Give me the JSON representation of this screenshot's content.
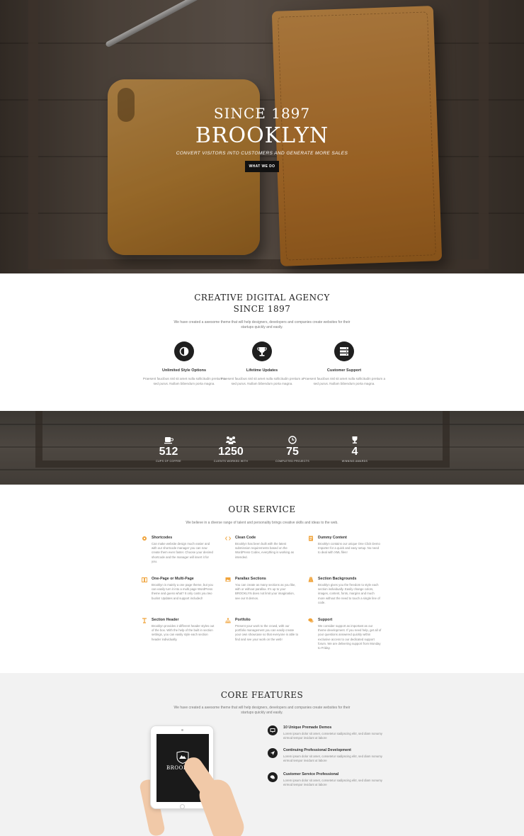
{
  "hero": {
    "since": "SINCE 1897",
    "title": "BROOKLYN",
    "subtitle": "CONVERT VISITORS INTO CUSTOMERS AND GENERATE MORE SALES",
    "button": "WHAT WE DO"
  },
  "agency": {
    "title_line1": "CREATIVE DIGITAL AGENCY",
    "title_line2": "SINCE 1897",
    "intro": "We have created a awesome theme that will help designers, developers and companies create websites for their startups quickly and easily.",
    "features": [
      {
        "icon": "contrast-icon",
        "title": "Unlimited Style Options",
        "desc": "Praesent faucibus nisl sit amet nulla sollicitudin pretium a sed purus. Nullam bibendum porta magna."
      },
      {
        "icon": "trophy-icon",
        "title": "Lifetime Updates",
        "desc": "Praesent faucibus nisl sit amet nulla sollicitudin pretium a sed purus. Nullam bibendum porta magna."
      },
      {
        "icon": "server-icon",
        "title": "Customer Support",
        "desc": "Praesent faucibus nisl sit amet nulla sollicitudin pretium a sed purus. Nullam bibendum porta magna."
      }
    ]
  },
  "stats": [
    {
      "icon": "coffee-cup-icon",
      "value": "512",
      "label": "CUPS OF COFFEE"
    },
    {
      "icon": "users-icon",
      "value": "1250",
      "label": "CLIENTS WORKED WITH"
    },
    {
      "icon": "clock-icon",
      "value": "75",
      "label": "COMPLETED PROJECTS"
    },
    {
      "icon": "trophy-icon",
      "value": "4",
      "label": "WINNING AWARDS"
    }
  ],
  "service": {
    "title": "OUR SERVICE",
    "intro": "We believe in a diverse range of talent and personality brings creative skills and ideas to the web.",
    "items": [
      {
        "icon": "gear-icon",
        "title": "Shortcodes",
        "desc": "Can make website design much easier and with our shortcode manager you can now create them even faster. Choose your desired shortcode and the manager will insert it for you."
      },
      {
        "icon": "code-icon",
        "title": "Clean Code",
        "desc": "Brooklyn has been built with the latest submission requirements based on the WordPress Codex, everything is working as intended."
      },
      {
        "icon": "document-icon",
        "title": "Dummy Content",
        "desc": "Brooklyn contains our unique One Click Demo Importer for a quick and easy setup. No need to deal with XML files!"
      },
      {
        "icon": "book-icon",
        "title": "One-Page or Multi-Page",
        "desc": "Brooklyn is mainly a one page theme, but you can easily turn it into a multi page WordPress theme and guess what? It only costs you two bucks! Updates and support included!"
      },
      {
        "icon": "image-icon",
        "title": "Parallax Sections",
        "desc": "You can create as many sections as you like, with or without parallax. It's up to you! BROOKLYN does not limit your imagination, see our 8 demos."
      },
      {
        "icon": "road-icon",
        "title": "Section Backgrounds",
        "desc": "Brooklyn gives you the freedom to style each section individually. Easily change colors, images, content, fonts, margins and much more without the need to touch a single line of code."
      },
      {
        "icon": "header-icon",
        "title": "Section Header",
        "desc": "Brooklyn provides 2 different header styles out of the box. With the help of the built in section settings, you can easily style each section header individually."
      },
      {
        "icon": "sitemap-icon",
        "title": "Portfolio",
        "desc": "Present your work to the crowd, with our portfolio management you can easily create your own showcase so that everyone is able to find and see your work on the web!"
      },
      {
        "icon": "chat-icon",
        "title": "Support",
        "desc": "We consider support as important as our theme development. If you need help, get all of your questions answered quickly within exclusive access to our dedicated support forum. We are delivering support from Monday to Friday."
      }
    ]
  },
  "core": {
    "title": "CORE FEATURES",
    "intro": "We have created a awesome theme that will help designers, developers and companies create websites for their startups quickly and easily.",
    "tablet_logo": "BROOKLYN",
    "items": [
      {
        "icon": "monitor-icon",
        "title": "10 Unique Premade Demos",
        "desc": "Lorem ipsum dolor sit amet, consetetur sadipscing elitr, sed diam nonumy eirmod tempor invidunt ut labore"
      },
      {
        "icon": "paper-plane-icon",
        "title": "Continuing Professional Development",
        "desc": "Lorem ipsum dolor sit amet, consetetur sadipscing elitr, sed diam nonumy eirmod tempor invidunt ut labore"
      },
      {
        "icon": "speech-bubble-icon",
        "title": "Customer Service Professional",
        "desc": "Lorem ipsum dolor sit amet, consetetur sadipscing elitr, sed diam nonumy eirmod tempor invidunt ut labore"
      }
    ]
  },
  "colors": {
    "accent": "#f0a33a",
    "dark": "#1f1f1f"
  }
}
